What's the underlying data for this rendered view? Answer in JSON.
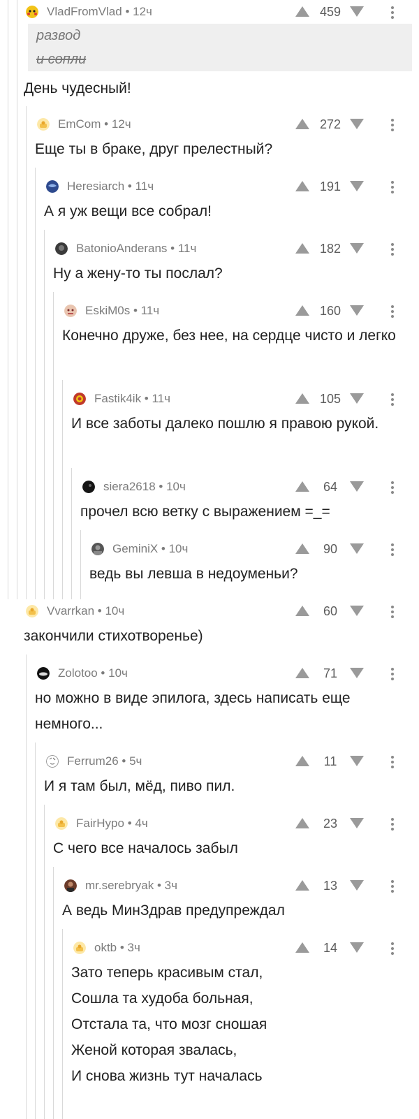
{
  "comments": [
    {
      "username": "VladFromVlad",
      "meta": "12ч",
      "rating": "459",
      "avatar": "pikachu-avatar",
      "quote": [
        "развод",
        "и сопли"
      ],
      "text": "День чудесный!"
    },
    {
      "username": "EmCom",
      "meta": "12ч",
      "rating": "272",
      "avatar": "default-avatar",
      "text": "Еще ты в браке, друг прелестный?"
    },
    {
      "username": "Heresiarch",
      "meta": "11ч",
      "rating": "191",
      "avatar": "globe-avatar",
      "text": "А я уж вещи все собрал!"
    },
    {
      "username": "BatonioAnderans",
      "meta": "11ч",
      "rating": "182",
      "avatar": "dark-avatar",
      "text": "Ну а жену-то ты послал?"
    },
    {
      "username": "EskiM0s",
      "meta": "11ч",
      "rating": "160",
      "avatar": "face-avatar",
      "text": "Конечно друже, без нее, на сердце чисто и легко"
    },
    {
      "username": "Fastik4ik",
      "meta": "11ч",
      "rating": "105",
      "avatar": "emblem-avatar",
      "text": "И все заботы далеко пошлю я правою рукой."
    },
    {
      "username": "siera2618",
      "meta": "10ч",
      "rating": "64",
      "avatar": "black-avatar",
      "text": "прочел всю ветку с выражением =_="
    },
    {
      "username": "GeminiX",
      "meta": "10ч",
      "rating": "90",
      "avatar": "portrait-avatar",
      "text": "ведь вы левша в недоуменьи?"
    },
    {
      "username": "Vvarrkan",
      "meta": "10ч",
      "rating": "60",
      "avatar": "default-avatar",
      "text": "закончили стихотворенье)"
    },
    {
      "username": "Zolotoo",
      "meta": "10ч",
      "rating": "71",
      "avatar": "car-avatar",
      "text": "но можно в виде эпилога, здесь написать еще немного..."
    },
    {
      "username": "Ferrum26",
      "meta": "5ч",
      "rating": "11",
      "avatar": "sketch-avatar",
      "text": "И я там был, мёд, пиво пил."
    },
    {
      "username": "FairHypo",
      "meta": "4ч",
      "rating": "23",
      "avatar": "default-avatar",
      "text": "С чего все началось забыл"
    },
    {
      "username": "mr.serebryak",
      "meta": "3ч",
      "rating": "13",
      "avatar": "person-avatar",
      "text": "А ведь МинЗдрав предупреждал"
    },
    {
      "username": "oktb",
      "meta": "3ч",
      "rating": "14",
      "avatar": "default-avatar",
      "text": "Зато теперь красивым стал,\nСошла та худоба больная,\nОтстала та, что мозг сношая\nЖеной которая звалась,\nИ снова жизнь тут началась"
    }
  ]
}
